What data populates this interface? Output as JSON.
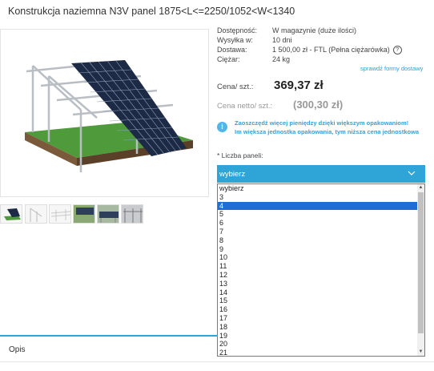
{
  "product": {
    "title": "Konstrukcja naziemna N3V panel 1875<L<=2250/1052<W<1340"
  },
  "info": {
    "availability_label": "Dostępność:",
    "availability_value": "W magazynie (duże ilości)",
    "shipping_label": "Wysyłka w:",
    "shipping_value": "10 dni",
    "delivery_label": "Dostawa:",
    "delivery_value": "1 500,00 zł - FTL (Pełna ciężarówka)",
    "weight_label": "Ciężar:",
    "weight_value": "24 kg",
    "delivery_link": "sprawdź formy dostawy",
    "help_icon": "?"
  },
  "price": {
    "gross_label": "Cena/ szt.:",
    "gross_value": "369,37 zł",
    "net_label": "Cena netto/ szt.:",
    "net_value": "(300,30 zł)"
  },
  "promo": {
    "icon": "i",
    "line1": "Zaoszczędź więcej pieniędzy dzięki większym opakowaniom!",
    "line2": "Im większa jednostka opakowania, tym niższa cena jednostkowa"
  },
  "quantity": {
    "label": "* Liczba paneli:",
    "selected_display": "wybierz",
    "options": [
      "wybierz",
      "3",
      "4",
      "5",
      "6",
      "7",
      "8",
      "9",
      "10",
      "11",
      "12",
      "13",
      "14",
      "15",
      "16",
      "17",
      "18",
      "19",
      "20",
      "21"
    ],
    "highlighted_option": "4"
  },
  "tabs": {
    "opis": "Opis"
  },
  "colors": {
    "accent": "#2fa4d6",
    "selected_option": "#1e6ed8",
    "promo_text": "#3a9fd2"
  }
}
